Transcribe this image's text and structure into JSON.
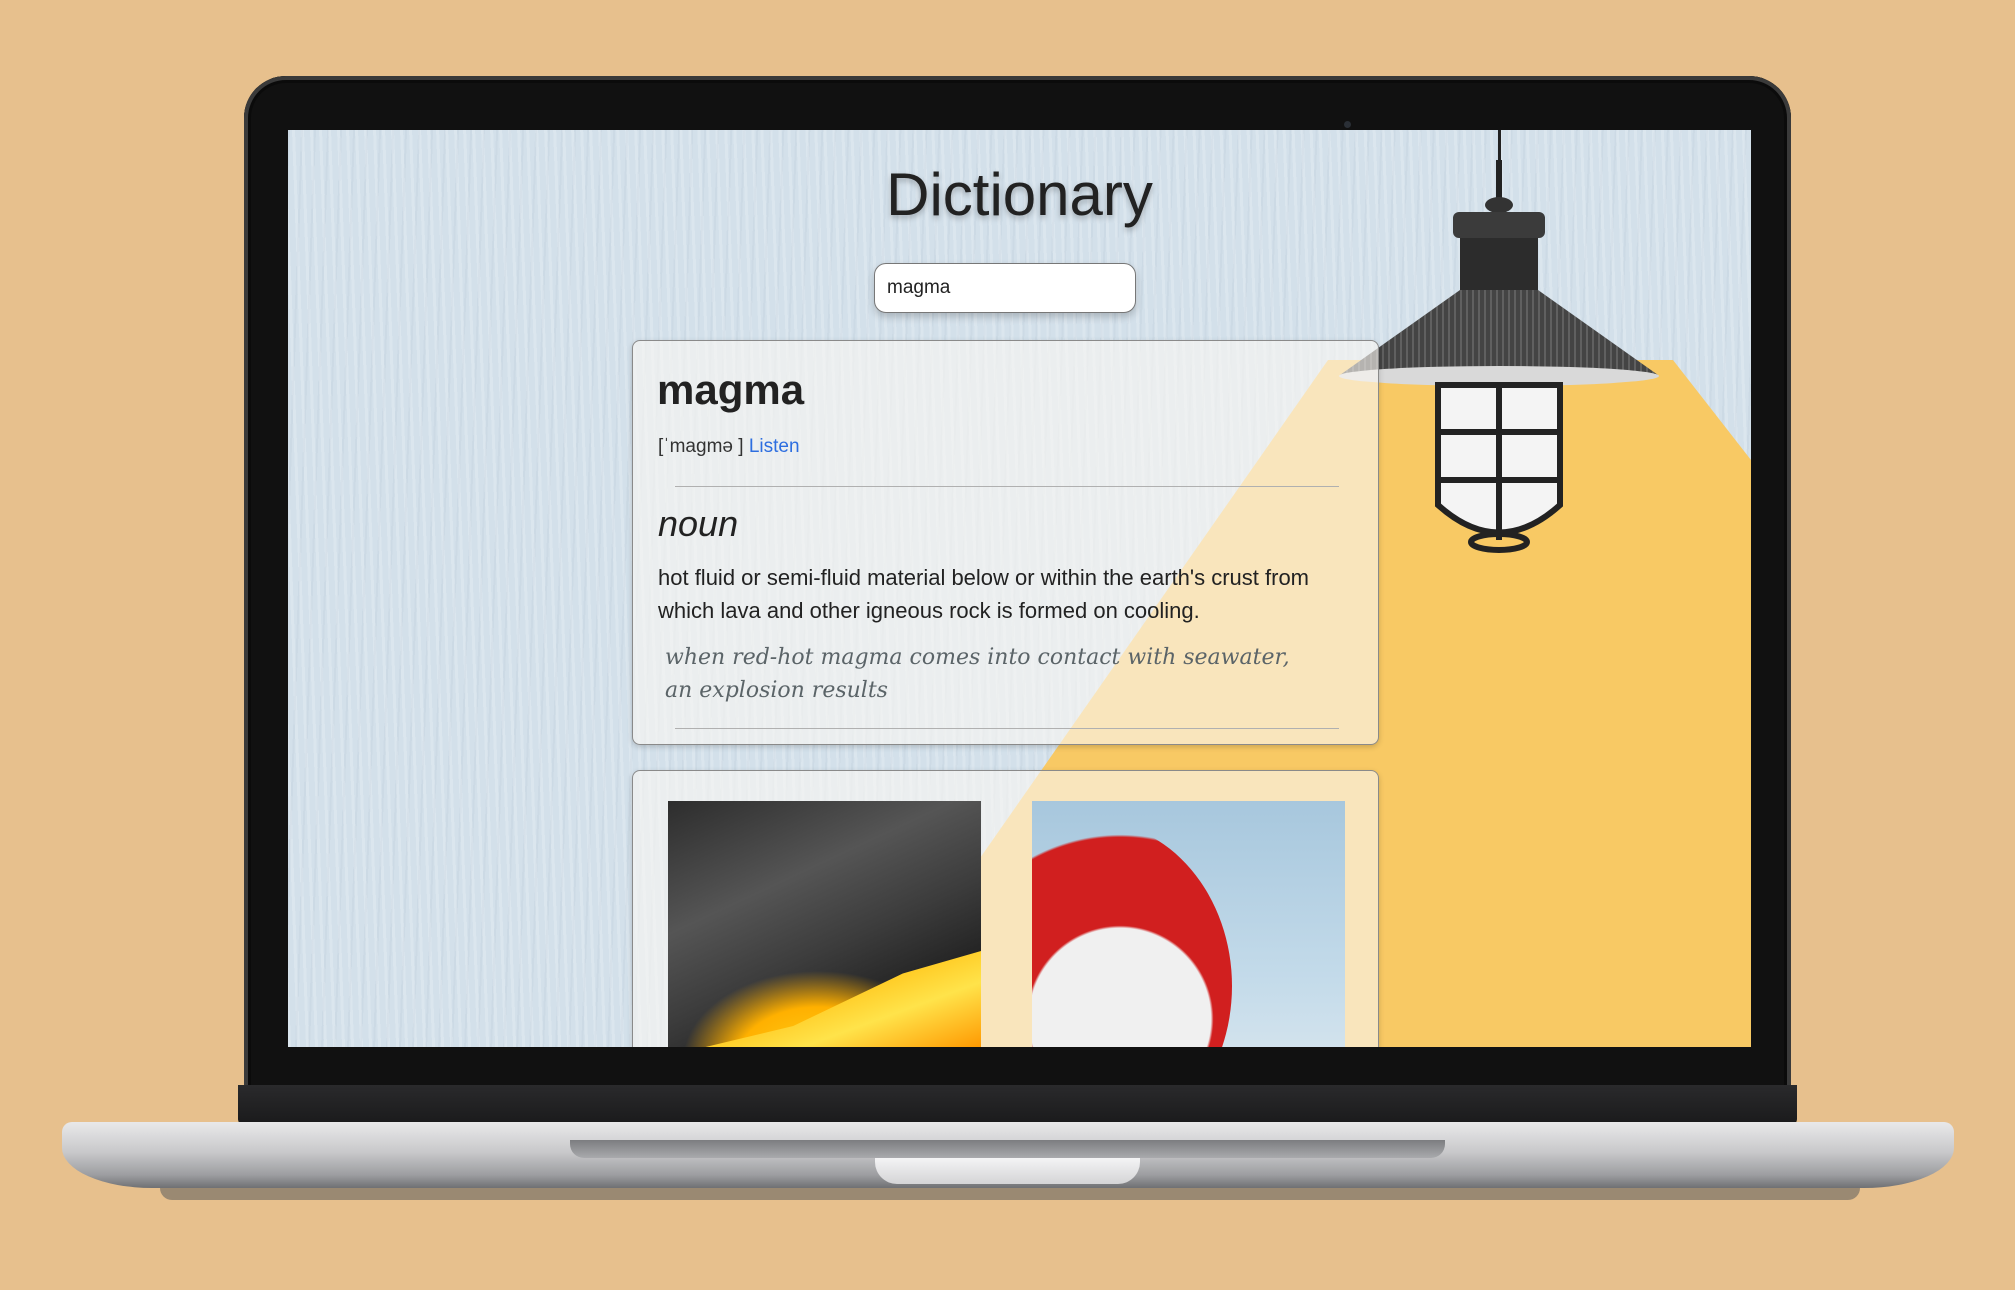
{
  "app": {
    "title": "Dictionary"
  },
  "search": {
    "value": "magma"
  },
  "entry": {
    "word": "magma",
    "phonetic_open": "[",
    "phonetic": "ˈmagmə",
    "phonetic_close": "]",
    "listen_label": "Listen",
    "meanings": [
      {
        "part_of_speech": "noun",
        "definition": "hot fluid or semi-fluid material below or within the earth's crust from which lava and other igneous rock is formed on cooling.",
        "example": "when red-hot magma comes into contact with seawater, an explosion results"
      }
    ]
  },
  "colors": {
    "backdrop": "#e7c08d",
    "wall": "#d3e0ea",
    "light_beam": "#f8c964",
    "link": "#2d6ee0"
  },
  "icons": {
    "lamp": "pendant-lamp-illustration"
  }
}
